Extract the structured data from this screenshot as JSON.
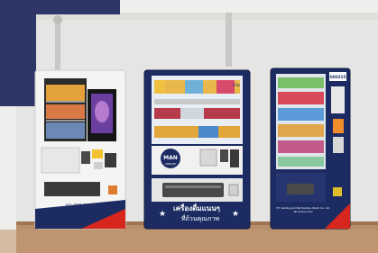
{
  "scene": {
    "colors": {
      "wall": "#e9e9e7",
      "floor": "#b58b66",
      "machine_white": "#f4f4f2",
      "machine_navy": "#1c2c63",
      "accent_red": "#d7261e",
      "overlay_navy": "#2e3668"
    }
  },
  "machines": {
    "left": {
      "phone": "02-465-0010"
    },
    "center": {
      "logo": "MAN",
      "logo_sub": "UNIQUE",
      "thai_line1": "เครื่องดื่มแนนๆ",
      "thai_line2": "ที่ถ้วนคุณภาพ",
      "price_tag": "25฿"
    },
    "right": {
      "brand_tag": "G00225",
      "company_line1": "T.E. Vending and Merchandise (Siam) Co., Ltd.",
      "company_line2": "Tel. 0-2xxx-xxxx"
    }
  }
}
